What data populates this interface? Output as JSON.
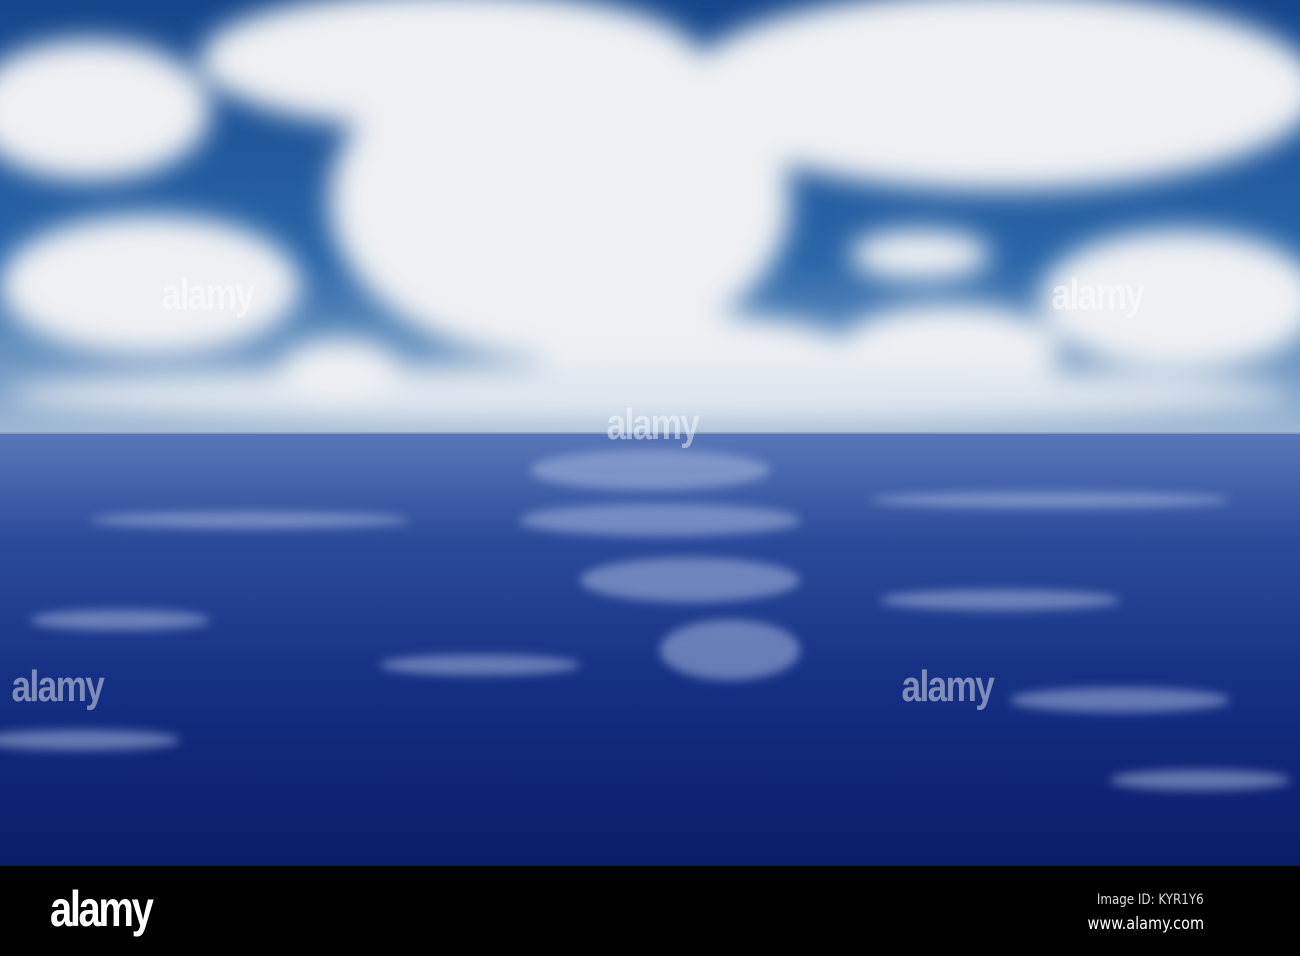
{
  "watermark": {
    "brand": "alamy"
  },
  "footer": {
    "logo": "alamy",
    "image_id": "Image ID: KYR1Y6",
    "url": "www.alamy.com"
  },
  "colors": {
    "sky": "#1f5a9e",
    "sea_deep": "#0c1f6a",
    "sea_light": "#5a7cc0",
    "cloud": "#f2f3f5"
  }
}
